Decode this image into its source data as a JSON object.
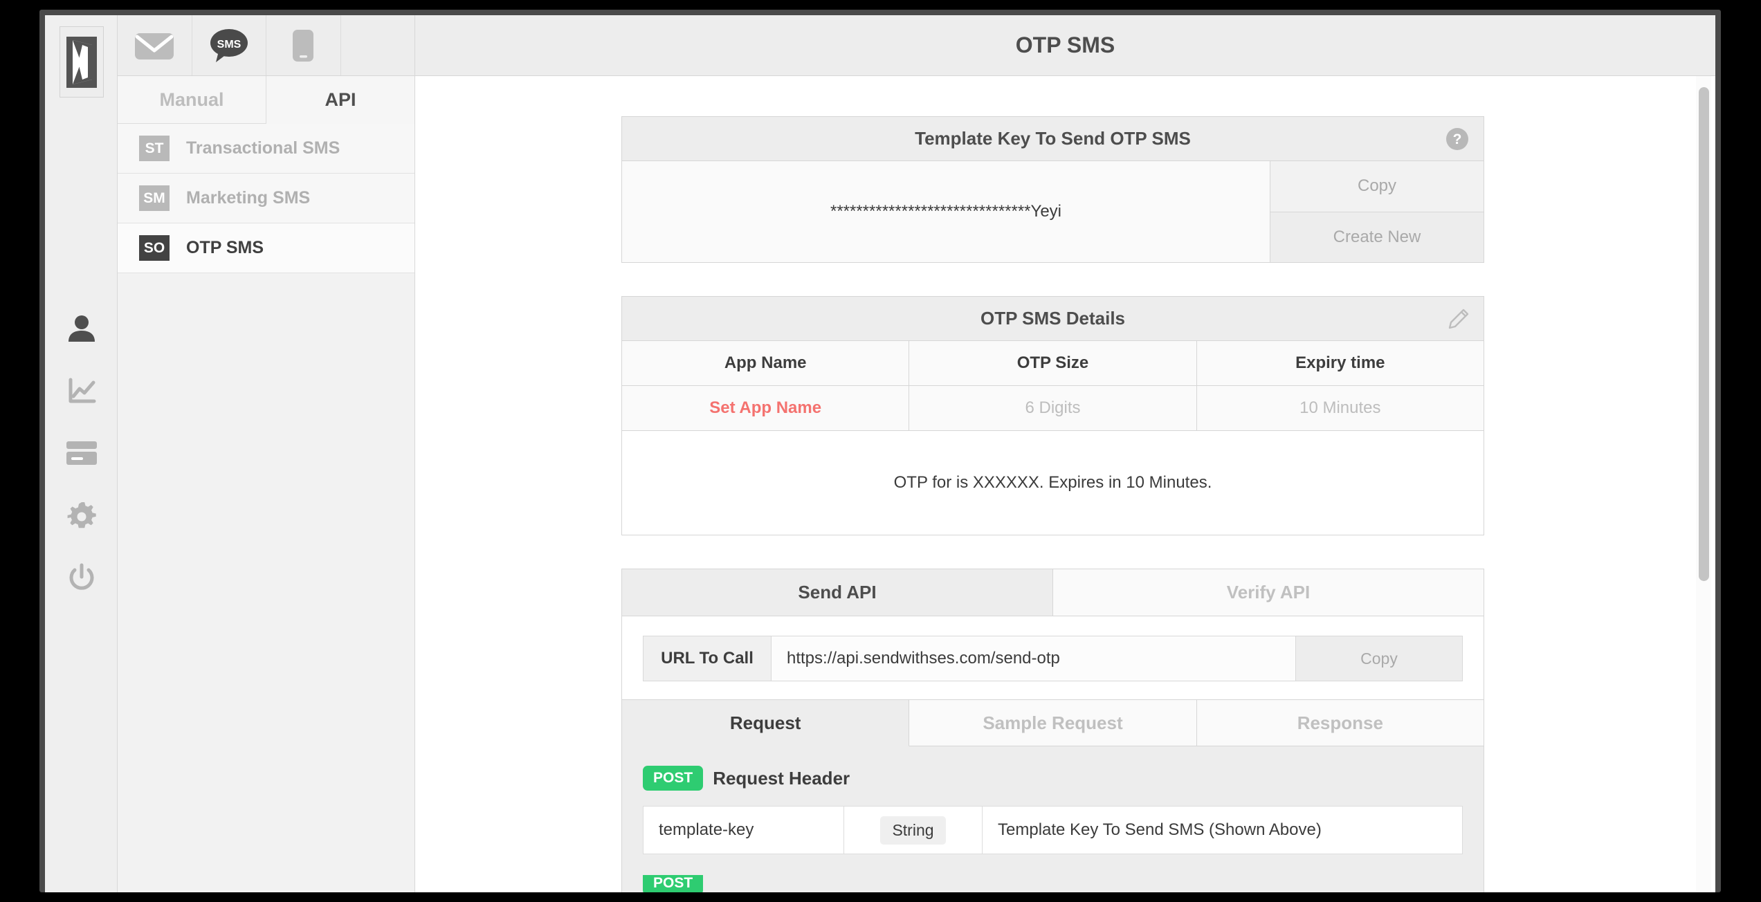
{
  "app": {
    "logo_icon": "open-door-icon"
  },
  "channel_tabs": [
    {
      "name": "email",
      "icon": "envelope-icon",
      "active": false
    },
    {
      "name": "sms",
      "icon": "sms-bubble-icon",
      "active": true
    },
    {
      "name": "mobile",
      "icon": "mobile-phone-icon",
      "active": false
    },
    {
      "name": "empty",
      "icon": "",
      "active": false
    }
  ],
  "mode_tabs": [
    {
      "label": "Manual",
      "active": false
    },
    {
      "label": "API",
      "active": true
    }
  ],
  "nav_items": [
    {
      "badge": "ST",
      "label": "Transactional SMS",
      "active": false
    },
    {
      "badge": "SM",
      "label": "Marketing SMS",
      "active": false
    },
    {
      "badge": "SO",
      "label": "OTP SMS",
      "active": true
    }
  ],
  "rail_icons": [
    {
      "name": "user-icon"
    },
    {
      "name": "analytics-chart-icon"
    },
    {
      "name": "credit-card-icon"
    },
    {
      "name": "gear-icon"
    },
    {
      "name": "power-icon"
    }
  ],
  "header": {
    "title": "OTP SMS"
  },
  "template_key_panel": {
    "title": "Template Key To Send OTP SMS",
    "help_icon": "question-mark-icon",
    "masked_key": "*******************************Yeyi",
    "copy_label": "Copy",
    "create_new_label": "Create New"
  },
  "details_panel": {
    "title": "OTP SMS Details",
    "edit_icon": "pencil-icon",
    "columns": [
      "App Name",
      "OTP Size",
      "Expiry time"
    ],
    "values": [
      "Set App Name",
      "6 Digits",
      "10 Minutes"
    ],
    "preview_message": "OTP for is XXXXXX. Expires in 10 Minutes.",
    "accent_color": "#f4726f"
  },
  "api_panel": {
    "tabs": [
      {
        "label": "Send API",
        "active": true
      },
      {
        "label": "Verify API",
        "active": false
      }
    ],
    "url_label": "URL To Call",
    "url_value": "https://api.sendwithses.com/send-otp",
    "url_copy_label": "Copy",
    "request_tabs": [
      {
        "label": "Request",
        "active": true
      },
      {
        "label": "Sample Request",
        "active": false
      },
      {
        "label": "Response",
        "active": false
      }
    ],
    "sections": [
      {
        "verb": "POST",
        "title": "Request Header",
        "rows": [
          {
            "name": "template-key",
            "type": "String",
            "description": "Template Key To Send SMS (Shown Above)"
          }
        ]
      }
    ],
    "verb_color": "#2ecc71"
  }
}
